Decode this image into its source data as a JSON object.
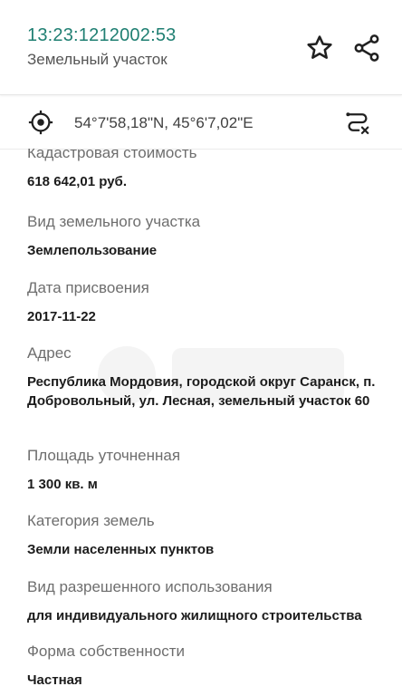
{
  "header": {
    "title": "13:23:1212002:53",
    "subtitle": "Земельный участок"
  },
  "coords": {
    "text": "54°7'58,18\"N, 45°6'7,02\"E"
  },
  "fields": [
    {
      "label": "Кадастровая стоимость",
      "value": "618 642,01 руб."
    },
    {
      "label": "Вид земельного участка",
      "value": "Землепользование"
    },
    {
      "label": "Дата присвоения",
      "value": "2017-11-22"
    },
    {
      "label": "Адрес",
      "value": "Республика Мордовия, городской округ Саранск, п. Добровольный, ул. Лесная, земельный участок 60"
    },
    {
      "label": "Площадь уточненная",
      "value": "1 300 кв. м"
    },
    {
      "label": "Категория земель",
      "value": "Земли населенных пунктов"
    },
    {
      "label": "Вид разрешенного использования",
      "value": "для индивидуального жилищного строительства"
    },
    {
      "label": "Форма собственности",
      "value": "Частная"
    }
  ],
  "icons": {
    "favorite": "star-icon",
    "share": "share-icon",
    "location": "crosshair-icon",
    "route": "route-icon"
  },
  "colors": {
    "accent": "#1f7f72",
    "label": "#6e6e6e",
    "value": "#1c1c1c"
  }
}
